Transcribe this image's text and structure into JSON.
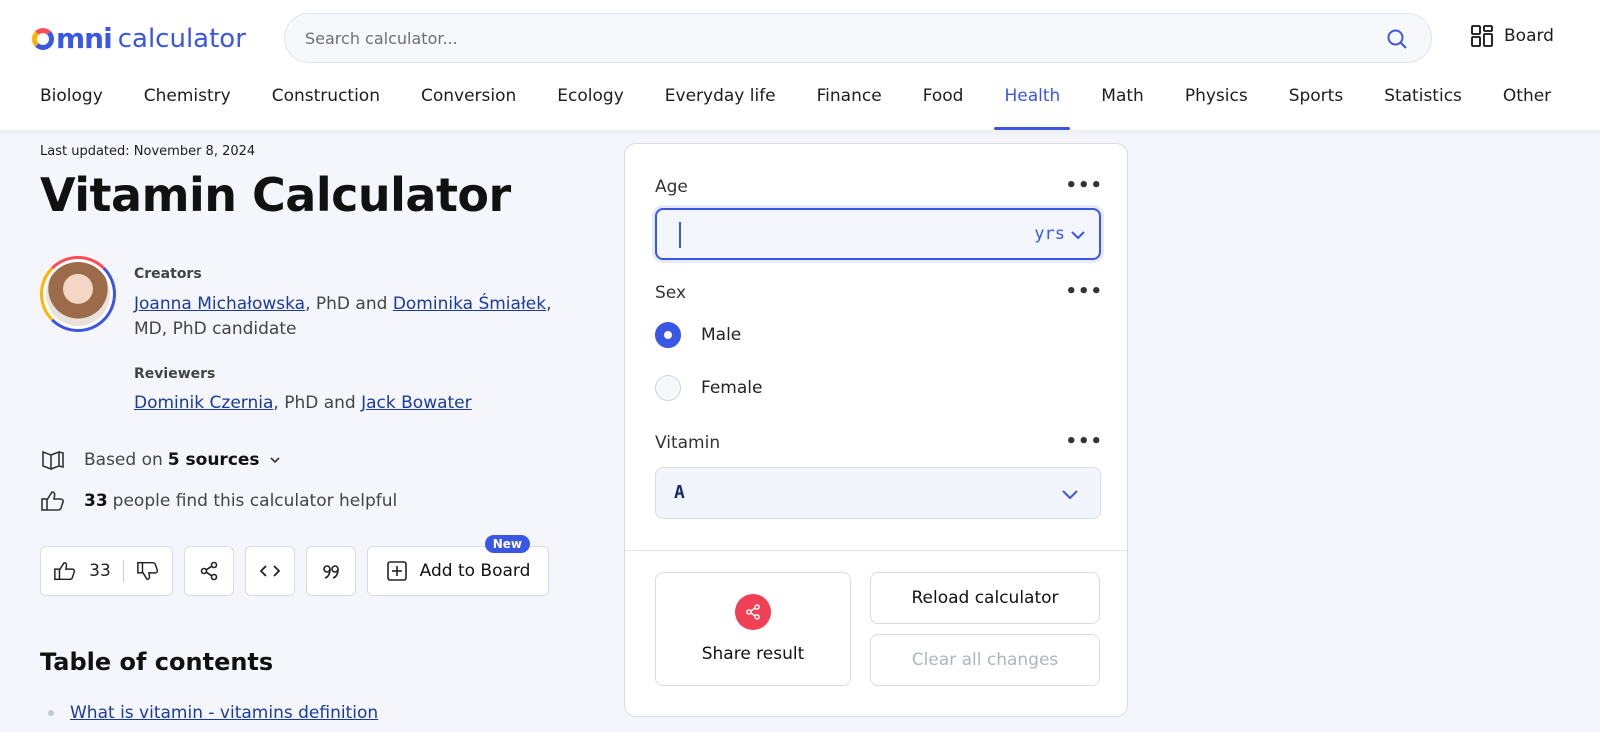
{
  "header": {
    "logo_brand": "omni",
    "logo_word": "calculator",
    "search_placeholder": "Search calculator...",
    "board_label": "Board"
  },
  "nav": {
    "items": [
      "Biology",
      "Chemistry",
      "Construction",
      "Conversion",
      "Ecology",
      "Everyday life",
      "Finance",
      "Food",
      "Health",
      "Math",
      "Physics",
      "Sports",
      "Statistics",
      "Other"
    ],
    "active": "Health"
  },
  "article": {
    "updated_label": "Last updated:",
    "updated_date": "November 8, 2024",
    "title": "Vitamin Calculator",
    "creators_label": "Creators",
    "creator1": "Joanna Michałowska",
    "creator1_suffix": ", PhD and ",
    "creator2": "Dominika Śmiałek",
    "creator2_suffix": ", MD, PhD candidate",
    "reviewers_label": "Reviewers",
    "reviewer1": "Dominik Czernia",
    "reviewer_mid": ", PhD and ",
    "reviewer2": "Jack Bowater",
    "sources_prefix": "Based on",
    "sources_count": "5 sources",
    "helpful_count": "33",
    "helpful_text": "people find this calculator helpful",
    "like_count": "33",
    "add_board_label": "Add to Board",
    "new_badge": "New",
    "toc_title": "Table of contents",
    "toc_items": [
      "What is vitamin - vitamins definition"
    ]
  },
  "calculator": {
    "age_label": "Age",
    "age_value": "",
    "age_unit": "yrs",
    "sex_label": "Sex",
    "sex_options": [
      "Male",
      "Female"
    ],
    "sex_selected": "Male",
    "vitamin_label": "Vitamin",
    "vitamin_value": "A",
    "share_label": "Share result",
    "reload_label": "Reload calculator",
    "clear_label": "Clear all changes",
    "more_glyph": "•••"
  },
  "colors": {
    "accent": "#3a56e4",
    "share": "#ef4056",
    "link": "#1a3b9c"
  }
}
